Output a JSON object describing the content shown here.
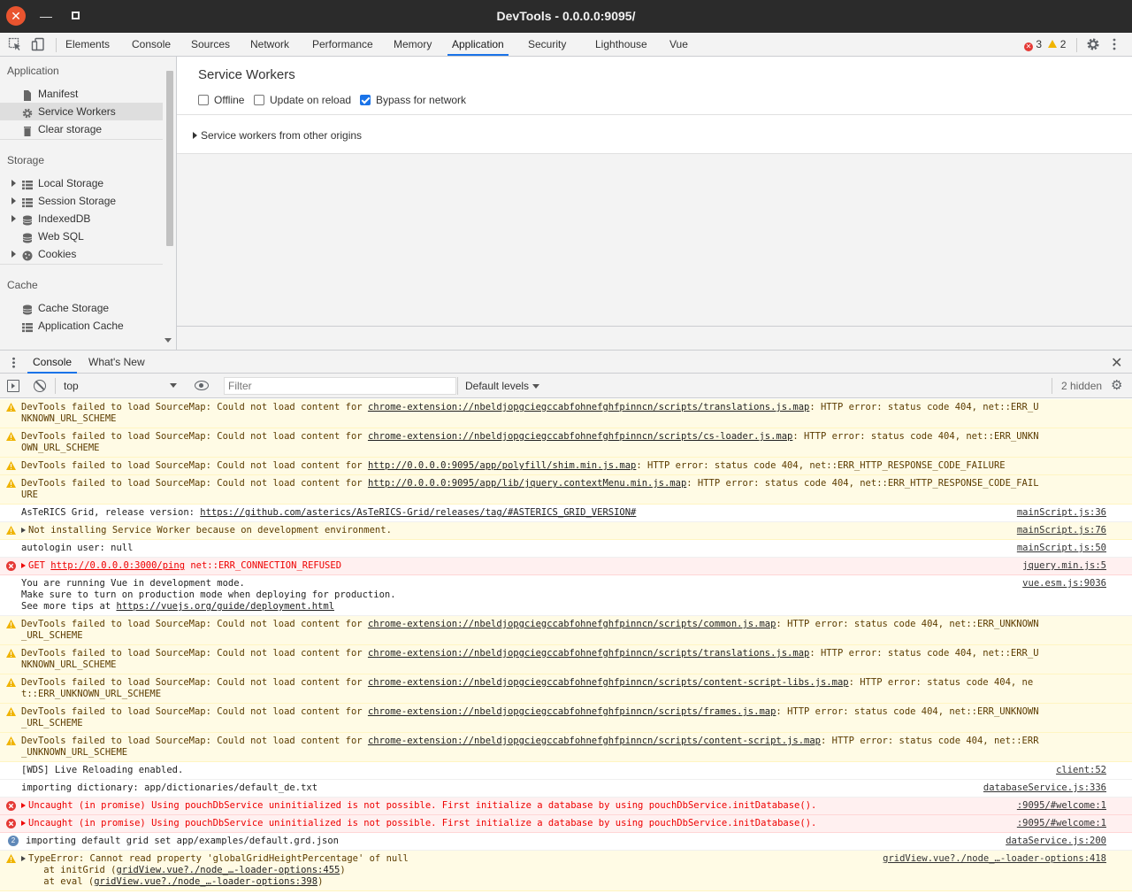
{
  "window": {
    "title": "DevTools - 0.0.0.0:9095/",
    "close_glyph": "✕",
    "minimize_glyph": "—"
  },
  "tabs": [
    {
      "label": "Elements"
    },
    {
      "label": "Console"
    },
    {
      "label": "Sources"
    },
    {
      "label": "Network"
    },
    {
      "label": "Performance"
    },
    {
      "label": "Memory"
    },
    {
      "label": "Application"
    },
    {
      "label": "Security"
    },
    {
      "label": "Lighthouse"
    },
    {
      "label": "Vue"
    }
  ],
  "active_tab": "Application",
  "counts": {
    "errors": "3",
    "warnings": "2"
  },
  "sidebar": {
    "sections": [
      {
        "heading": "Application",
        "items": [
          "Manifest",
          "Service Workers",
          "Clear storage"
        ]
      },
      {
        "heading": "Storage",
        "items": [
          "Local Storage",
          "Session Storage",
          "IndexedDB",
          "Web SQL",
          "Cookies"
        ]
      },
      {
        "heading": "Cache",
        "items": [
          "Cache Storage",
          "Application Cache"
        ]
      }
    ],
    "selected": "Service Workers"
  },
  "main": {
    "title": "Service Workers",
    "checkboxes": [
      {
        "label": "Offline",
        "checked": false
      },
      {
        "label": "Update on reload",
        "checked": false
      },
      {
        "label": "Bypass for network",
        "checked": true
      }
    ],
    "other_origins": "Service workers from other origins"
  },
  "drawer": {
    "tabs": [
      "Console",
      "What's New"
    ],
    "close_glyph": "✕"
  },
  "console_toolbar": {
    "context": "top",
    "filter_placeholder": "Filter",
    "levels": "Default levels",
    "hidden": "2 hidden",
    "settings_glyph": "⚙"
  },
  "messages": [
    {
      "level": "warning",
      "text": "DevTools failed to load SourceMap: Could not load content for ",
      "link": "chrome-extension://nbeldjopgciegccabfohnefghfpinncn/scripts/translations.js.map",
      "after": ": HTTP error: status code 404, net::ERR_UNKNOWN_URL_SCHEME",
      "source": ""
    },
    {
      "level": "warning",
      "text": "DevTools failed to load SourceMap: Could not load content for ",
      "link": "chrome-extension://nbeldjopgciegccabfohnefghfpinncn/scripts/cs-loader.js.map",
      "after": ": HTTP error: status code 404, net::ERR_UNKNOWN_URL_SCHEME",
      "source": ""
    },
    {
      "level": "warning",
      "text": "DevTools failed to load SourceMap: Could not load content for ",
      "link": "http://0.0.0.0:9095/app/polyfill/shim.min.js.map",
      "after": ": HTTP error: status code 404, net::ERR_HTTP_RESPONSE_CODE_FAILURE",
      "source": ""
    },
    {
      "level": "warning",
      "text": "DevTools failed to load SourceMap: Could not load content for ",
      "link": "http://0.0.0.0:9095/app/lib/jquery.contextMenu.min.js.map",
      "after": ": HTTP error: status code 404, net::ERR_HTTP_RESPONSE_CODE_FAILURE",
      "source": ""
    },
    {
      "level": "info",
      "text": "AsTeRICS Grid, release version: ",
      "link": "https://github.com/asterics/AsTeRICS-Grid/releases/tag/#ASTERICS_GRID_VERSION#",
      "after": "",
      "source": "mainScript.js:36"
    },
    {
      "level": "warning",
      "caret": true,
      "text": "Not installing Service Worker because on development environment.",
      "link": "",
      "after": "",
      "source": "mainScript.js:76"
    },
    {
      "level": "info",
      "text": "autologin user: null",
      "link": "",
      "after": "",
      "source": "mainScript.js:50"
    },
    {
      "level": "error",
      "caret": true,
      "text": "GET ",
      "link": "http://0.0.0.0:3000/ping",
      "after": " net::ERR_CONNECTION_REFUSED",
      "source": "jquery.min.js:5"
    },
    {
      "level": "info",
      "text": "You are running Vue in development mode.\nMake sure to turn on production mode when deploying for production.\nSee more tips at ",
      "link": "https://vuejs.org/guide/deployment.html",
      "after": "",
      "source": "vue.esm.js:9036"
    },
    {
      "level": "warning",
      "text": "DevTools failed to load SourceMap: Could not load content for ",
      "link": "chrome-extension://nbeldjopgciegccabfohnefghfpinncn/scripts/common.js.map",
      "after": ": HTTP error: status code 404, net::ERR_UNKNOWN_URL_SCHEME",
      "source": ""
    },
    {
      "level": "warning",
      "text": "DevTools failed to load SourceMap: Could not load content for ",
      "link": "chrome-extension://nbeldjopgciegccabfohnefghfpinncn/scripts/translations.js.map",
      "after": ": HTTP error: status code 404, net::ERR_UNKNOWN_URL_SCHEME",
      "source": ""
    },
    {
      "level": "warning",
      "text": "DevTools failed to load SourceMap: Could not load content for ",
      "link": "chrome-extension://nbeldjopgciegccabfohnefghfpinncn/scripts/content-script-libs.js.map",
      "after": ": HTTP error: status code 404, net::ERR_UNKNOWN_URL_SCHEME",
      "source": ""
    },
    {
      "level": "warning",
      "text": "DevTools failed to load SourceMap: Could not load content for ",
      "link": "chrome-extension://nbeldjopgciegccabfohnefghfpinncn/scripts/frames.js.map",
      "after": ": HTTP error: status code 404, net::ERR_UNKNOWN_URL_SCHEME",
      "source": ""
    },
    {
      "level": "warning",
      "text": "DevTools failed to load SourceMap: Could not load content for ",
      "link": "chrome-extension://nbeldjopgciegccabfohnefghfpinncn/scripts/content-script.js.map",
      "after": ": HTTP error: status code 404, net::ERR_UNKNOWN_URL_SCHEME",
      "source": ""
    },
    {
      "level": "info",
      "text": "[WDS] Live Reloading enabled.",
      "link": "",
      "after": "",
      "source": "client:52"
    },
    {
      "level": "info",
      "text": "importing dictionary: app/dictionaries/default_de.txt",
      "link": "",
      "after": "",
      "source": "databaseService.js:336"
    },
    {
      "level": "error",
      "caret": true,
      "text": "Uncaught (in promise) Using pouchDbService uninitialized is not possible. First initialize a database by using pouchDbService.initDatabase().",
      "link": "",
      "after": "",
      "source": ":9095/#welcome:1"
    },
    {
      "level": "error",
      "caret": true,
      "text": "Uncaught (in promise) Using pouchDbService uninitialized is not possible. First initialize a database by using pouchDbService.initDatabase().",
      "link": "",
      "after": "",
      "source": ":9095/#welcome:1"
    },
    {
      "level": "info",
      "badge": "2",
      "text": "importing default grid set app/examples/default.grd.json",
      "link": "",
      "after": "",
      "source": "dataService.js:200"
    },
    {
      "level": "warning",
      "caret": true,
      "text": "TypeError: Cannot read property 'globalGridHeightPercentage' of null\n    at initGrid (",
      "link": "gridView.vue?./node_…-loader-options:455",
      "after": ")\n    at eval (",
      "link2": "gridView.vue?./node_…-loader-options:398",
      "after2": ")",
      "source": "gridView.vue?./node_…-loader-options:418"
    }
  ]
}
